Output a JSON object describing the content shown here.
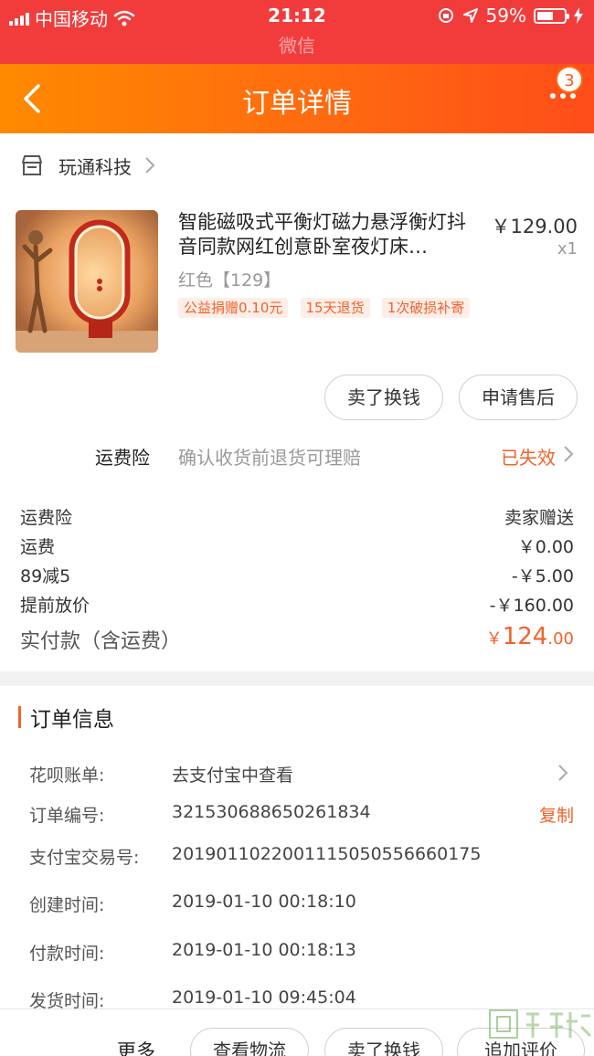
{
  "status_bar": {
    "carrier": "中国移动",
    "time": "21:12",
    "battery": "59%"
  },
  "wechat_label": "微信",
  "nav": {
    "title": "订单详情",
    "badge": "3"
  },
  "shop": {
    "name": "玩通科技"
  },
  "product": {
    "title": "智能磁吸式平衡灯磁力悬浮衡灯抖音同款网红创意卧室夜灯床…",
    "price": "￥129.00",
    "quantity": "x1",
    "sku": "红色【129】",
    "tags": [
      "公益捐赠0.10元",
      "15天退货",
      "1次破损补寄"
    ]
  },
  "actions": {
    "sell_label": "卖了换钱",
    "after_sale_label": "申请售后"
  },
  "insurance": {
    "label": "运费险",
    "description": "确认收货前退货可理赔",
    "status": "已失效"
  },
  "fees": [
    {
      "label": "运费险",
      "value": "卖家赠送"
    },
    {
      "label": "运费",
      "value": "￥0.00"
    },
    {
      "label": "89减5",
      "value": "-￥5.00"
    },
    {
      "label": "提前放价",
      "value": "-￥160.00"
    }
  ],
  "total": {
    "label": "实付款（含运费）",
    "currency": "￥",
    "integer": "124",
    "decimal": ".00"
  },
  "order_info": {
    "title": "订单信息",
    "rows": [
      {
        "key": "花呗账单:",
        "value": "去支付宝中查看"
      },
      {
        "key": "订单编号:",
        "value": "321530688650261834",
        "action": "复制"
      },
      {
        "key": "支付宝交易号:",
        "value": "2019011022001115050556660175"
      },
      {
        "key": "创建时间:",
        "value": "2019-01-10 00:18:10"
      },
      {
        "key": "付款时间:",
        "value": "2019-01-10 00:18:13"
      },
      {
        "key": "发货时间:",
        "value": "2019-01-10 09:45:04"
      }
    ]
  },
  "bottom_bar": {
    "more_label": "更多",
    "logistics_label": "查看物流",
    "sell_label": "卖了换钱",
    "review_label": "追加评价"
  },
  "colors": {
    "status_red": "#f23c3c",
    "nav_orange": "#ff6a10",
    "accent": "#f2622a"
  }
}
